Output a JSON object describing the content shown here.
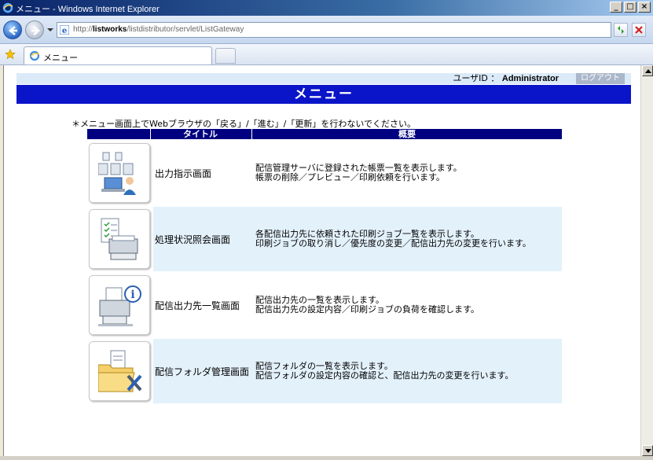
{
  "window": {
    "title": "メニュー - Windows Internet Explorer",
    "buttons": [
      "_",
      "□",
      "×"
    ]
  },
  "address": {
    "url_prefix": "http://",
    "url_host": "listworks",
    "url_path": "/listdistributor/servlet/ListGateway"
  },
  "tab": {
    "label": "メニュー"
  },
  "page": {
    "user_label": "ユーザID ： ",
    "user_id": "Administrator",
    "logout_label": "ログアウト",
    "header": "メニュー",
    "notice": "＊メニュー画面上でWebブラウザの「戻る」/「進む」/「更新」を行わないでください。",
    "col_title": "タイトル",
    "col_summary": "概要",
    "rows": [
      {
        "title": "出力指示画面",
        "desc1": "配信管理サーバに登録された帳票一覧を表示します。",
        "desc2": "帳票の削除／プレビュー／印刷依頼を行います。",
        "icon": "output-instruction-icon"
      },
      {
        "title": "処理状況照会画面",
        "desc1": "各配信出力先に依頼された印刷ジョブ一覧を表示します。",
        "desc2": "印刷ジョブの取り消し／優先度の変更／配信出力先の変更を行います。",
        "icon": "print-status-icon"
      },
      {
        "title": "配信出力先一覧画面",
        "desc1": "配信出力先の一覧を表示します。",
        "desc2": "配信出力先の設定内容／印刷ジョブの負荷を確認します。",
        "icon": "printer-info-icon"
      },
      {
        "title": "配信フォルダ管理画面",
        "desc1": "配信フォルダの一覧を表示します。",
        "desc2": "配信フォルダの設定内容の確認と、配信出力先の変更を行います。",
        "icon": "folder-tools-icon"
      }
    ]
  },
  "colors": {
    "header_bg": "#0a14c8",
    "table_head_bg": "#000080",
    "alt_row_bg": "#e3f1fb",
    "userbar_bg": "#dbeaf8"
  }
}
